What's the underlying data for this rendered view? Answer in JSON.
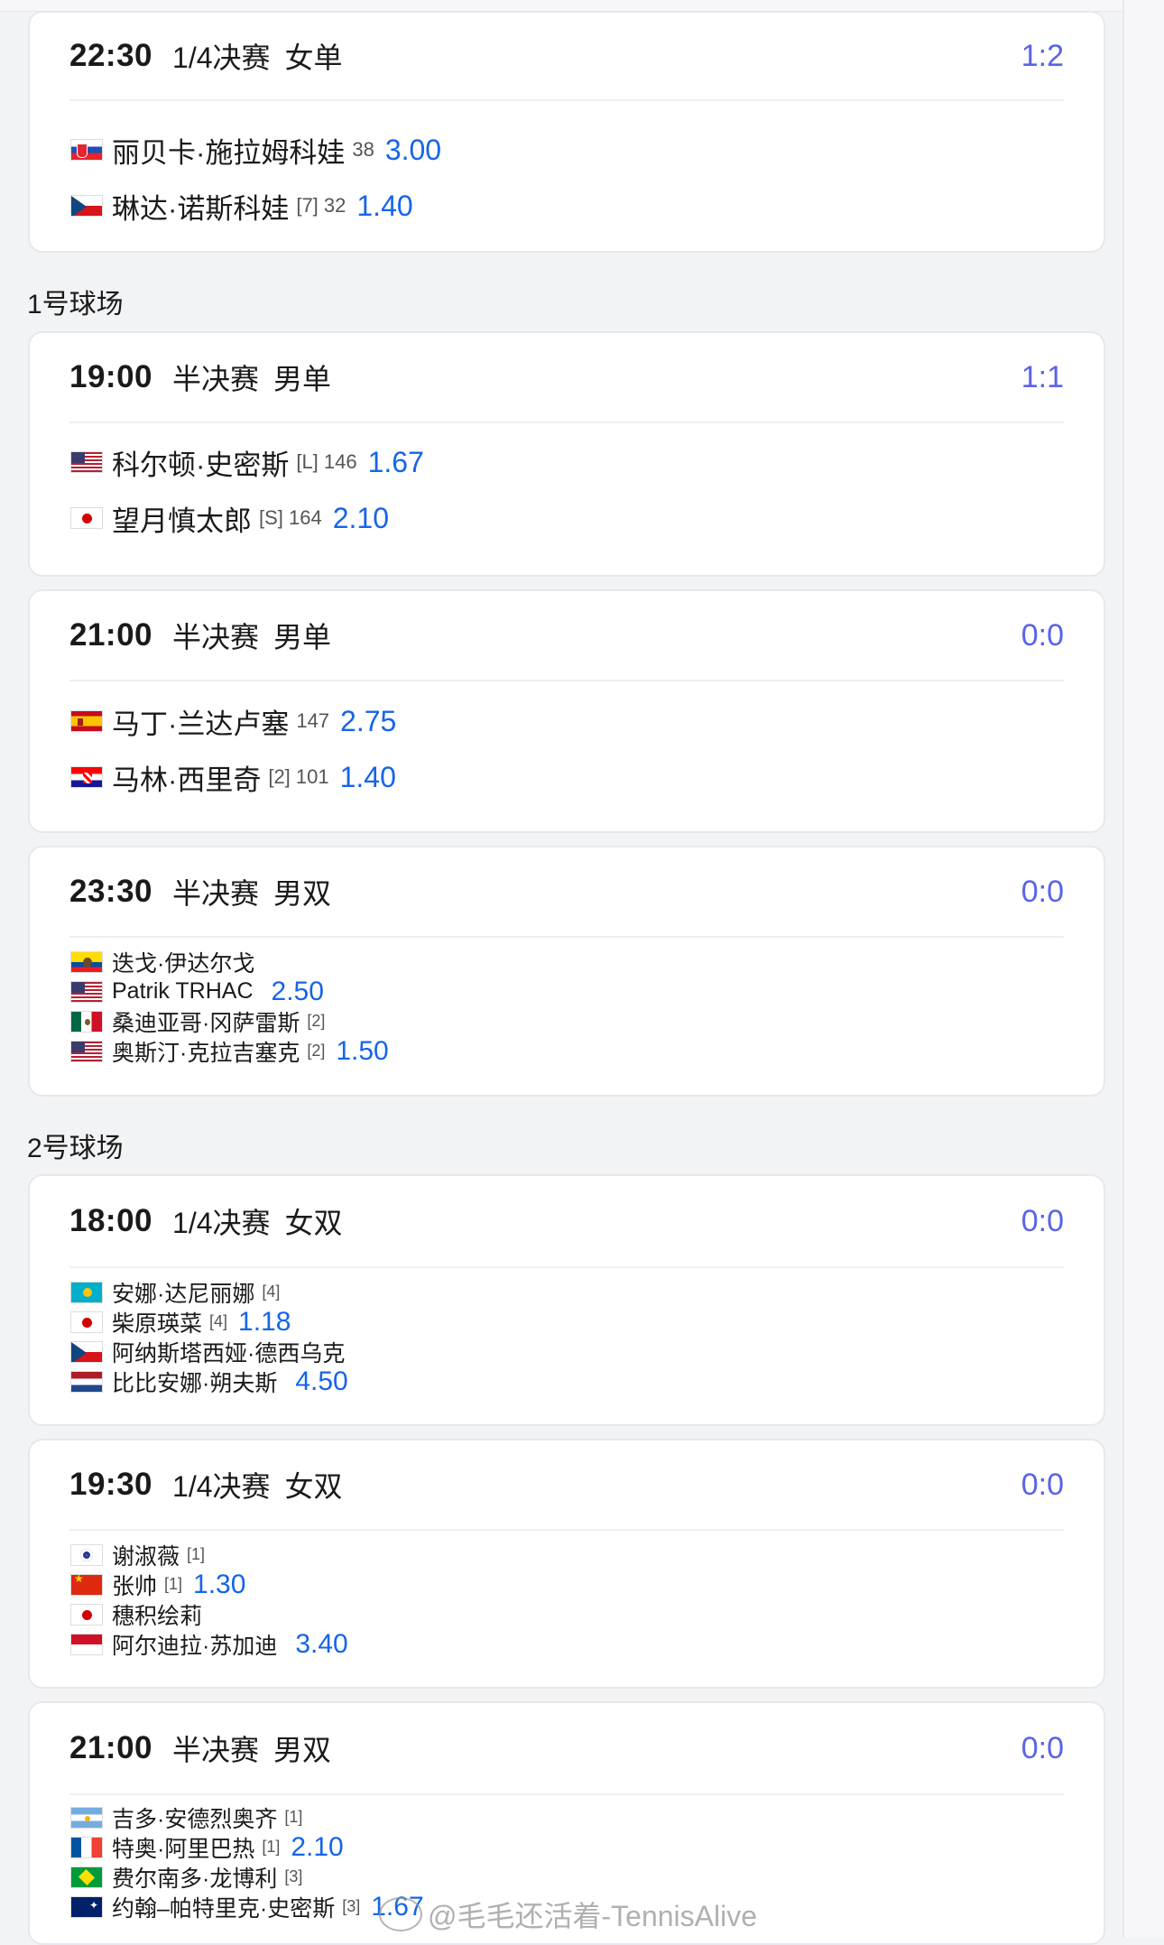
{
  "courts": [
    {
      "label": ""
    },
    {
      "label": "1号球场"
    },
    {
      "label": "2号球场"
    }
  ],
  "matches": [
    {
      "time": "22:30",
      "round": "1/4决赛",
      "event": "女单",
      "score": "1:2",
      "players": [
        {
          "flag": "flag-slovakia",
          "name": "丽贝卡·施拉姆科娃",
          "meta": "38",
          "odds": "3.00"
        },
        {
          "flag": "flag-czech",
          "name": "琳达·诺斯科娃",
          "meta": "[7] 32",
          "odds": "1.40"
        }
      ]
    },
    {
      "time": "19:00",
      "round": "半决赛",
      "event": "男单",
      "score": "1:1",
      "players": [
        {
          "flag": "flag-usa",
          "name": "科尔顿·史密斯",
          "meta": "[L] 146",
          "odds": "1.67"
        },
        {
          "flag": "flag-japan",
          "name": "望月慎太郎",
          "meta": "[S] 164",
          "odds": "2.10"
        }
      ]
    },
    {
      "time": "21:00",
      "round": "半决赛",
      "event": "男单",
      "score": "0:0",
      "players": [
        {
          "flag": "flag-spain",
          "name": "马丁·兰达卢塞",
          "meta": "147",
          "odds": "2.75"
        },
        {
          "flag": "flag-croatia",
          "name": "马林·西里奇",
          "meta": "[2] 101",
          "odds": "1.40"
        }
      ]
    },
    {
      "time": "23:30",
      "round": "半决赛",
      "event": "男双",
      "score": "0:0",
      "players": [
        {
          "flag": "flag-ecuador",
          "name": "迭戈·伊达尔戈",
          "meta": "",
          "odds": ""
        },
        {
          "flag": "flag-usa",
          "name": "Patrik TRHAC",
          "meta": "",
          "odds": "2.50"
        },
        {
          "flag": "flag-mexico",
          "name": "桑迪亚哥·冈萨雷斯",
          "meta": "[2]",
          "odds": ""
        },
        {
          "flag": "flag-usa",
          "name": "奥斯汀·克拉吉塞克",
          "meta": "[2]",
          "odds": "1.50"
        }
      ]
    },
    {
      "time": "18:00",
      "round": "1/4决赛",
      "event": "女双",
      "score": "0:0",
      "players": [
        {
          "flag": "flag-kazakhstan",
          "name": "安娜·达尼丽娜",
          "meta": "[4]",
          "odds": ""
        },
        {
          "flag": "flag-japan",
          "name": "柴原瑛菜",
          "meta": "[4]",
          "odds": "1.18"
        },
        {
          "flag": "flag-czech",
          "name": "阿纳斯塔西娅·德西乌克",
          "meta": "",
          "odds": ""
        },
        {
          "flag": "flag-netherlands",
          "name": "比比安娜·朔夫斯",
          "meta": "",
          "odds": "4.50"
        }
      ]
    },
    {
      "time": "19:30",
      "round": "1/4决赛",
      "event": "女双",
      "score": "0:0",
      "players": [
        {
          "flag": "flag-chinese-taipei",
          "name": "谢淑薇",
          "meta": "[1]",
          "odds": ""
        },
        {
          "flag": "flag-china",
          "name": "张帅",
          "meta": "[1]",
          "odds": "1.30"
        },
        {
          "flag": "flag-japan",
          "name": "穗积绘莉",
          "meta": "",
          "odds": ""
        },
        {
          "flag": "flag-indonesia",
          "name": "阿尔迪拉·苏加迪",
          "meta": "",
          "odds": "3.40"
        }
      ]
    },
    {
      "time": "21:00",
      "round": "半决赛",
      "event": "男双",
      "score": "0:0",
      "players": [
        {
          "flag": "flag-argentina",
          "name": "吉多·安德烈奥齐",
          "meta": "[1]",
          "odds": ""
        },
        {
          "flag": "flag-france",
          "name": "特奥·阿里巴热",
          "meta": "[1]",
          "odds": "2.10"
        },
        {
          "flag": "flag-brazil",
          "name": "费尔南多·龙博利",
          "meta": "[3]",
          "odds": ""
        },
        {
          "flag": "flag-australia",
          "name": "约翰–帕特里克·史密斯",
          "meta": "[3]",
          "odds": "1.67"
        }
      ]
    }
  ],
  "watermark": "@毛毛还活着-TennisAlive"
}
